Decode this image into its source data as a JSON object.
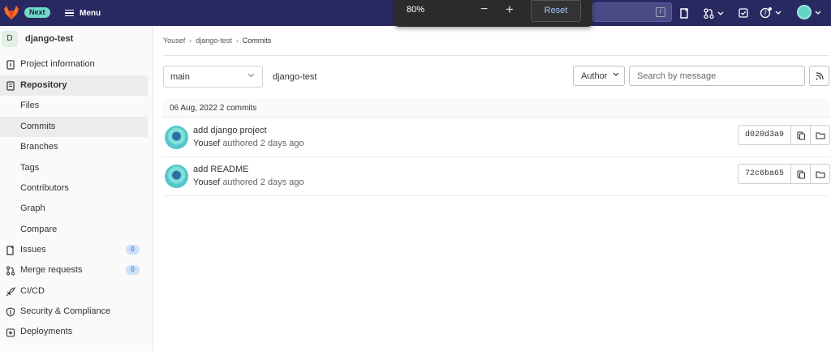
{
  "topbar": {
    "next_badge": "Next",
    "menu_label": "Menu",
    "search_shortcut": "/",
    "icons": [
      "tanuki-logo-icon",
      "hamburger-icon",
      "issues-icon",
      "merge-request-icon",
      "todo-icon",
      "help-icon",
      "user-avatar"
    ]
  },
  "zoom": {
    "level": "80%",
    "minus": "−",
    "plus": "+",
    "reset_label": "Reset"
  },
  "sidebar": {
    "project_initial": "D",
    "project_name": "django-test",
    "items": [
      {
        "label": "Project information",
        "icon": "info-icon"
      },
      {
        "label": "Repository",
        "icon": "repository-icon"
      },
      {
        "label": "Files"
      },
      {
        "label": "Commits"
      },
      {
        "label": "Branches"
      },
      {
        "label": "Tags"
      },
      {
        "label": "Contributors"
      },
      {
        "label": "Graph"
      },
      {
        "label": "Compare"
      },
      {
        "label": "Issues",
        "icon": "issues-icon",
        "badge": "0"
      },
      {
        "label": "Merge requests",
        "icon": "merge-request-icon",
        "badge": "0"
      },
      {
        "label": "CI/CD",
        "icon": "rocket-icon"
      },
      {
        "label": "Security & Compliance",
        "icon": "shield-icon"
      },
      {
        "label": "Deployments",
        "icon": "deployments-icon"
      }
    ]
  },
  "breadcrumb": [
    "Yousef",
    "django-test",
    "Commits"
  ],
  "filters": {
    "branch": "main",
    "project_path": "django-test",
    "author_label": "Author",
    "search_placeholder": "Search by message"
  },
  "commits_header": "06 Aug, 2022 2 commits",
  "commits": [
    {
      "title": "add django project",
      "author": "Yousef",
      "meta": "authored 2 days ago",
      "sha": "d020d3a9"
    },
    {
      "title": "add README",
      "author": "Yousef",
      "meta": "authored 2 days ago",
      "sha": "72c6ba65"
    }
  ],
  "colors": {
    "topbar": "#292961",
    "accent": "#6fdac8",
    "badge": "#cbe2f9"
  }
}
